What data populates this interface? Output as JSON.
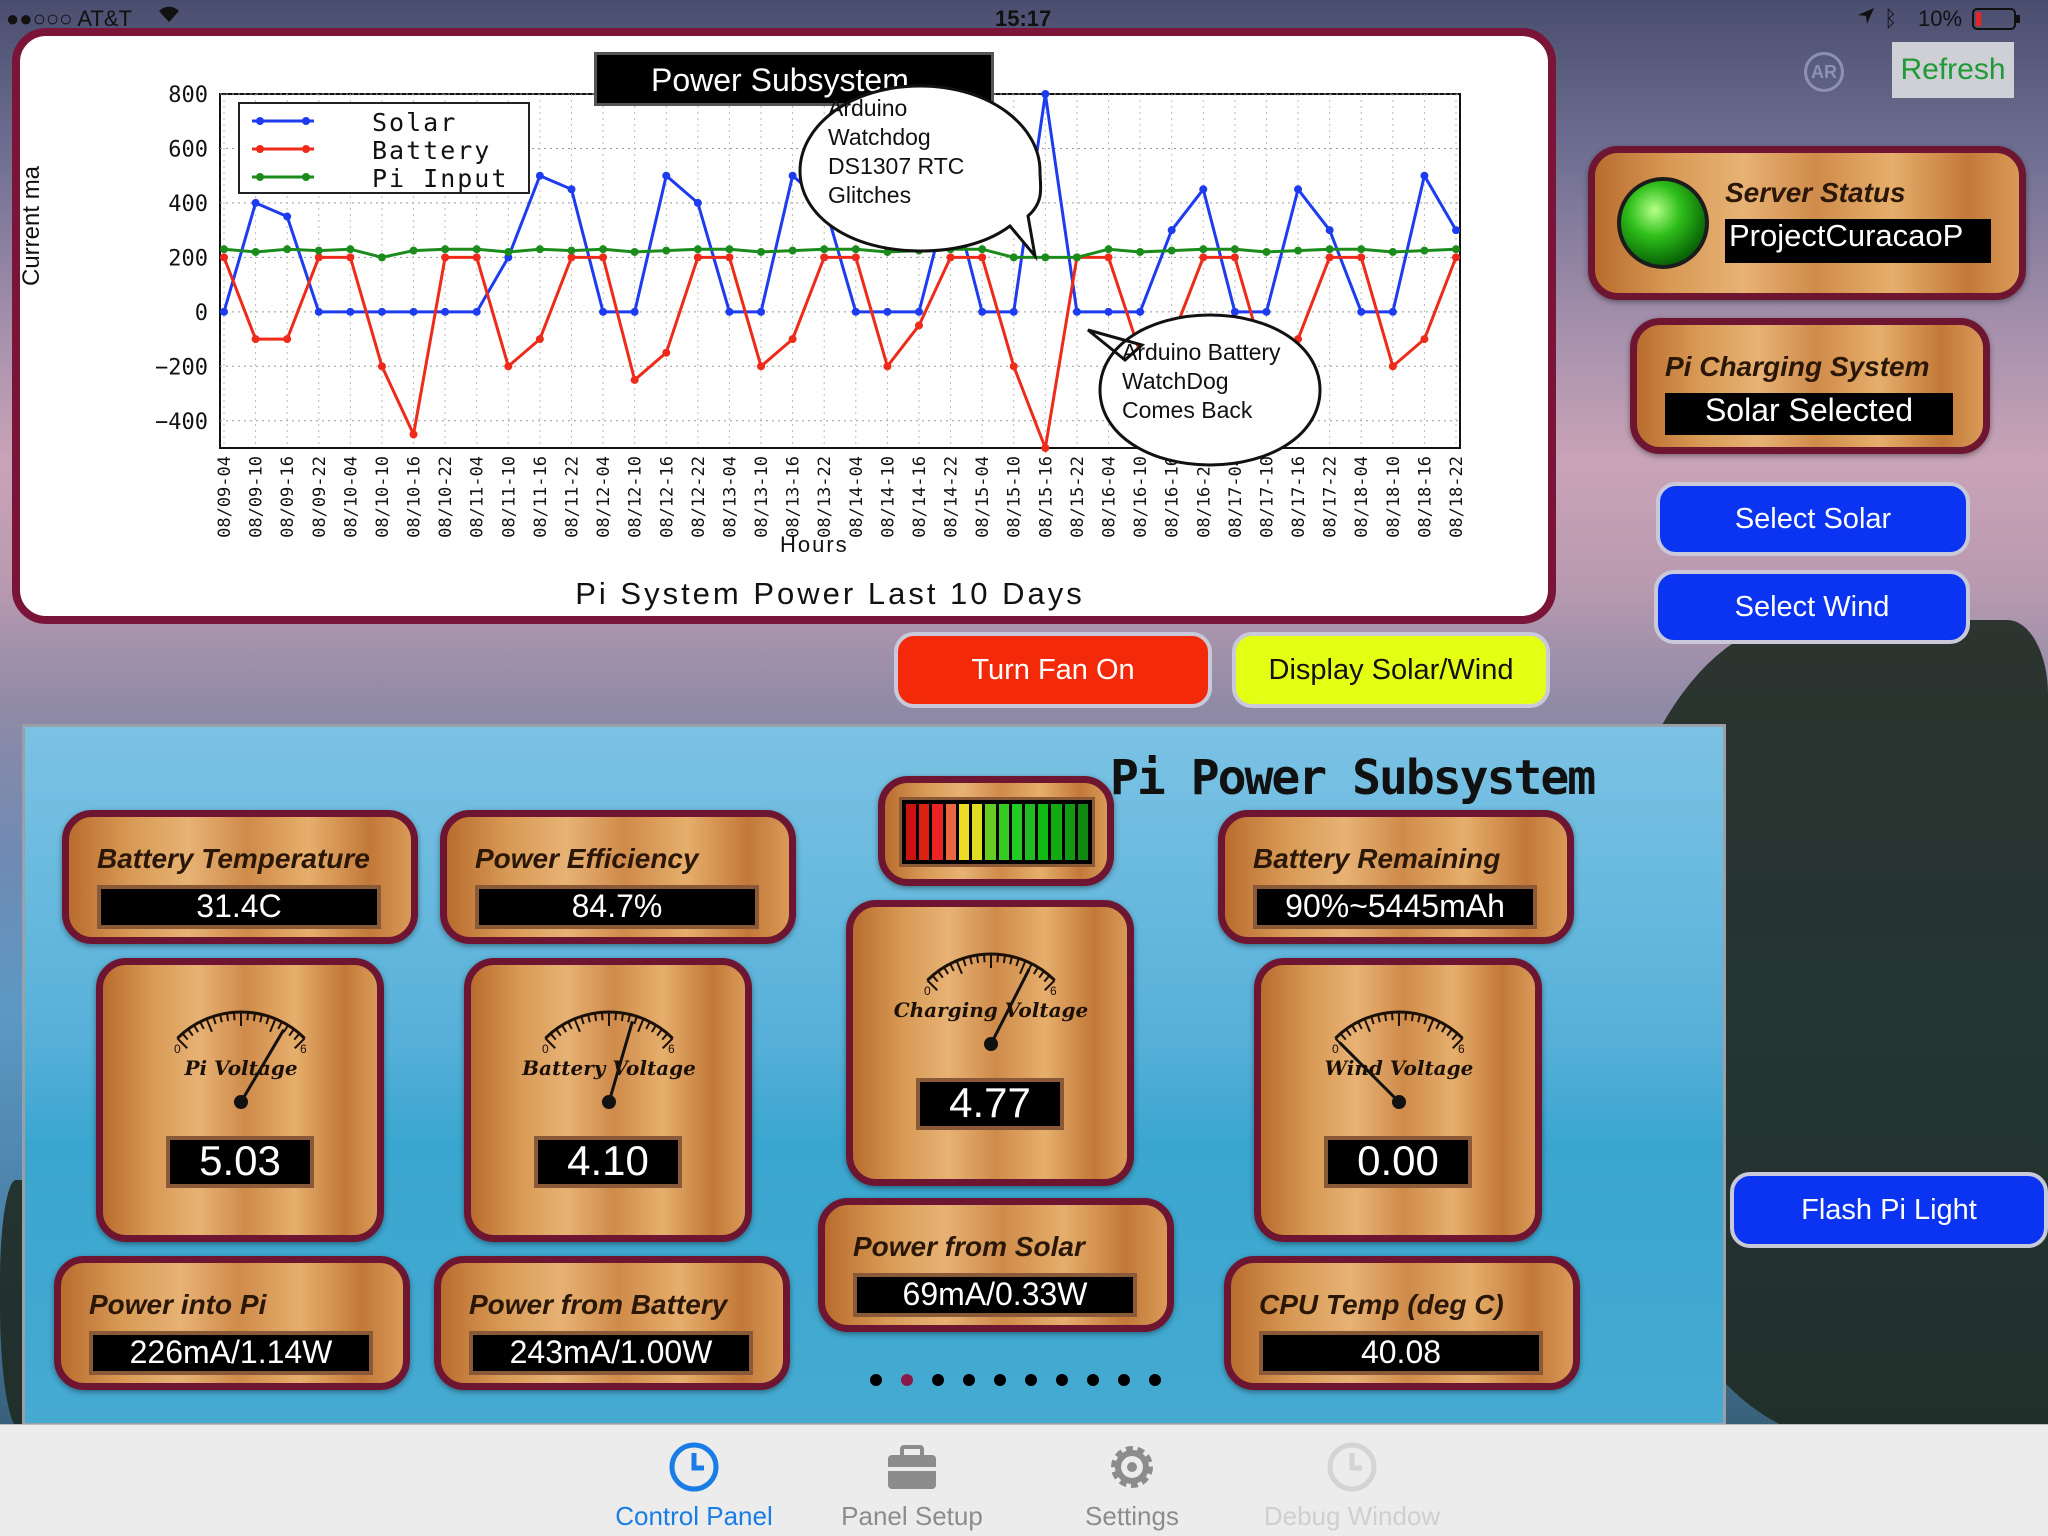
{
  "status_bar": {
    "carrier": "●●○○○ AT&T",
    "time": "15:17",
    "battery": "10%"
  },
  "header": {
    "ar_label": "AR",
    "refresh_label": "Refresh"
  },
  "chart_panel": {
    "banner": "Power Subsystem",
    "callout_top": [
      "Arduino",
      "Watchdog",
      "DS1307 RTC",
      "Glitches"
    ],
    "callout_bottom": [
      "Arduino Battery",
      "WatchDog",
      "Comes Back"
    ]
  },
  "chart_data": {
    "type": "line",
    "title": "Pi System Power Last 10 Days",
    "xlabel": "Hours",
    "ylabel": "Current ma",
    "ylim": [
      -500,
      800
    ],
    "yticks": [
      "800",
      "600",
      "400",
      "200",
      "0",
      "−200",
      "−400"
    ],
    "grid": true,
    "legend_position": "top-left",
    "categories": [
      "08/09-04",
      "08/09-10",
      "08/09-16",
      "08/09-22",
      "08/10-04",
      "08/10-10",
      "08/10-16",
      "08/10-22",
      "08/11-04",
      "08/11-10",
      "08/11-16",
      "08/11-22",
      "08/12-04",
      "08/12-10",
      "08/12-16",
      "08/12-22",
      "08/13-04",
      "08/13-10",
      "08/13-16",
      "08/13-22",
      "08/14-04",
      "08/14-10",
      "08/14-16",
      "08/14-22",
      "08/15-04",
      "08/15-10",
      "08/15-16",
      "08/15-22",
      "08/16-04",
      "08/16-10",
      "08/16-16",
      "08/16-22",
      "08/17-04",
      "08/17-10",
      "08/17-16",
      "08/17-22",
      "08/18-04",
      "08/18-10",
      "08/18-16",
      "08/18-22"
    ],
    "series": [
      {
        "name": "Solar",
        "color": "#1d3cf0",
        "values": [
          0,
          400,
          350,
          0,
          0,
          0,
          0,
          0,
          0,
          200,
          500,
          450,
          0,
          0,
          500,
          400,
          0,
          0,
          500,
          400,
          0,
          0,
          0,
          450,
          0,
          0,
          800,
          0,
          0,
          0,
          300,
          450,
          0,
          0,
          450,
          300,
          0,
          0,
          500,
          300
        ]
      },
      {
        "name": "Battery",
        "color": "#ee2a1a",
        "values": [
          200,
          -100,
          -100,
          200,
          200,
          -200,
          -450,
          200,
          200,
          -200,
          -100,
          200,
          200,
          -250,
          -150,
          200,
          200,
          -200,
          -100,
          200,
          200,
          -200,
          -50,
          200,
          200,
          -200,
          -500,
          200,
          200,
          -150,
          -100,
          200,
          200,
          -200,
          -100,
          200,
          200,
          -200,
          -100,
          200
        ]
      },
      {
        "name": "Pi Input",
        "color": "#1b8c1b",
        "values": [
          230,
          220,
          230,
          225,
          230,
          200,
          225,
          230,
          230,
          220,
          230,
          225,
          230,
          220,
          225,
          230,
          230,
          220,
          225,
          230,
          230,
          220,
          225,
          230,
          230,
          200,
          200,
          200,
          230,
          220,
          225,
          230,
          230,
          220,
          225,
          230,
          230,
          220,
          225,
          230
        ]
      }
    ]
  },
  "server_status": {
    "label": "Server Status",
    "value": "ProjectCuracaoP"
  },
  "charging": {
    "label": "Pi Charging System",
    "value": "Solar Selected"
  },
  "buttons": {
    "select_solar": "Select Solar",
    "select_wind": "Select Wind",
    "turn_fan": "Turn Fan On",
    "display_solar_wind": "Display Solar/Wind",
    "flash_light": "Flash Pi Light"
  },
  "subsystem": {
    "title": "Pi Power Subsystem",
    "battery_temp": {
      "label": "Battery Temperature",
      "value": "31.4C"
    },
    "power_eff": {
      "label": "Power Efficiency",
      "value": "84.7%"
    },
    "battery_remaining": {
      "label": "Battery Remaining",
      "value": "90%~5445mAh"
    },
    "level_meter": {
      "segments": 14,
      "lit": 14
    },
    "gauges": [
      {
        "label": "Pi Voltage",
        "value": "5.03",
        "level": 0.84
      },
      {
        "label": "Battery Voltage",
        "value": "4.10",
        "level": 0.68
      },
      {
        "label": "Charging Voltage",
        "value": "4.77",
        "level": 0.8
      },
      {
        "label": "Wind Voltage",
        "value": "0.00",
        "level": 0.0
      }
    ],
    "gauge_min": "0",
    "gauge_max": "6",
    "power_pi": {
      "label": "Power into Pi",
      "value": "226mA/1.14W"
    },
    "power_battery": {
      "label": "Power from Battery",
      "value": "243mA/1.00W"
    },
    "power_solar": {
      "label": "Power from Solar",
      "value": "69mA/0.33W"
    },
    "cpu_temp": {
      "label": "CPU Temp (deg C)",
      "value": "40.08"
    },
    "page_dots": 10,
    "active_dot": 1
  },
  "tabs": [
    {
      "label": "Control Panel",
      "icon": "clock-icon",
      "active": true
    },
    {
      "label": "Panel Setup",
      "icon": "toolbox-icon",
      "active": false
    },
    {
      "label": "Settings",
      "icon": "gear-icon",
      "active": false
    },
    {
      "label": "Debug Window",
      "icon": "clock-icon",
      "active": false,
      "disabled": true
    }
  ]
}
